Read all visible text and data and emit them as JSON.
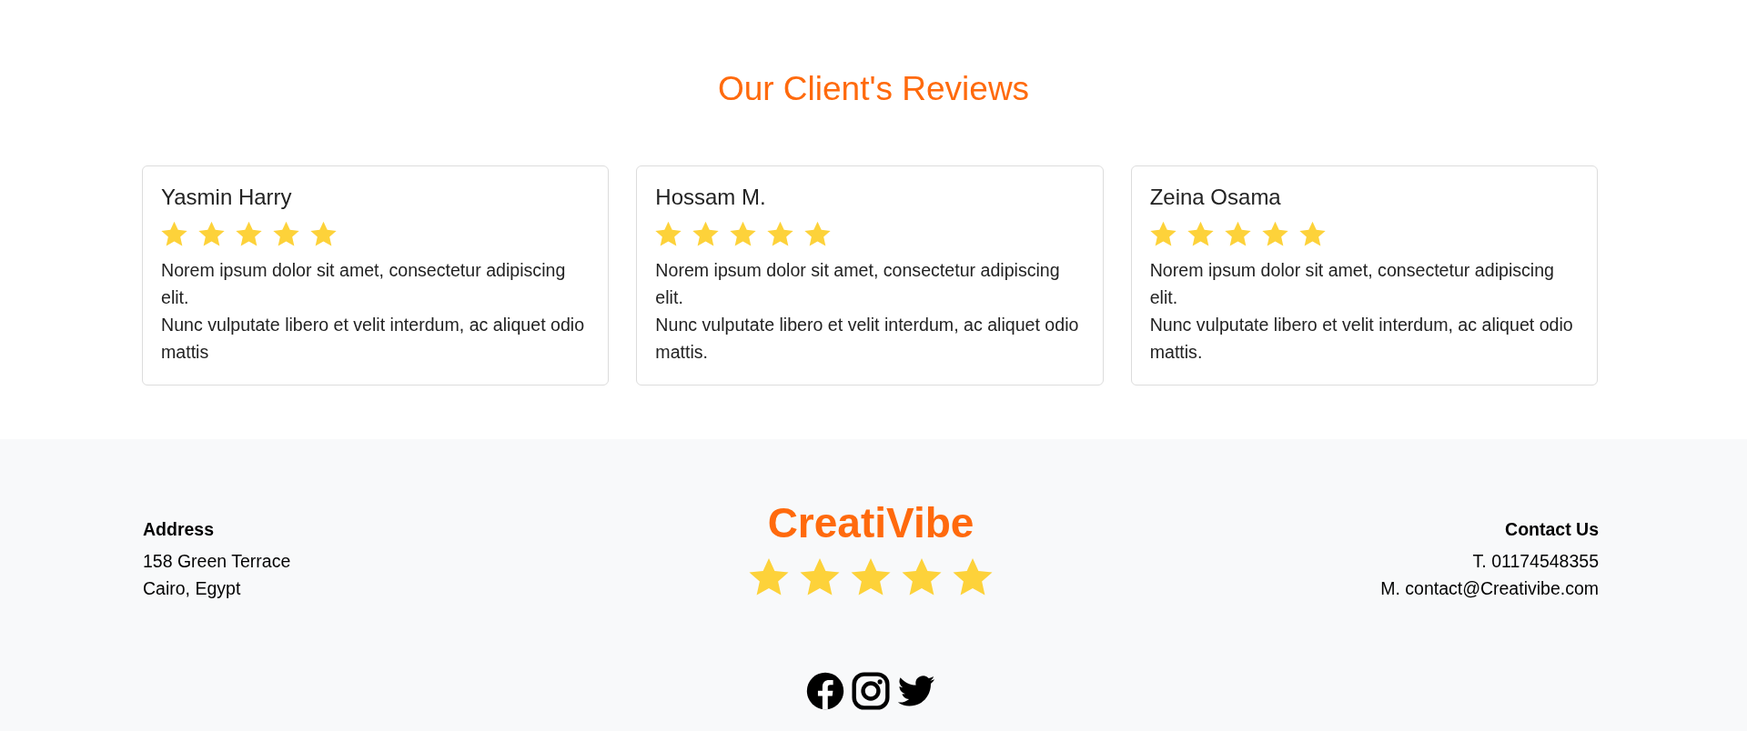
{
  "title": "Our Client's Reviews",
  "reviews": [
    {
      "name": "Yasmin Harry",
      "stars": 5,
      "text": "Norem ipsum dolor sit amet, consectetur adipiscing elit.\nNunc vulputate libero et velit interdum, ac aliquet odio mattis"
    },
    {
      "name": "Hossam M.",
      "stars": 5,
      "text": "Norem ipsum dolor sit amet, consectetur adipiscing elit.\nNunc vulputate libero et velit interdum, ac aliquet odio mattis."
    },
    {
      "name": "Zeina Osama",
      "stars": 5,
      "text": "Norem ipsum dolor sit amet, consectetur adipiscing elit.\nNunc vulputate libero et velit interdum, ac aliquet odio mattis."
    }
  ],
  "footer": {
    "address": {
      "heading": "Address",
      "lines": [
        "158 Green Terrace",
        "Cairo, Egypt"
      ]
    },
    "brand": {
      "name": "CreatiVibe",
      "stars": 5
    },
    "contact": {
      "heading": "Contact Us",
      "lines": [
        "T. 01174548355",
        "M. contact@Creativibe.com"
      ]
    },
    "social": [
      {
        "kind": "facebook"
      },
      {
        "kind": "instagram"
      },
      {
        "kind": "twitter"
      }
    ]
  }
}
